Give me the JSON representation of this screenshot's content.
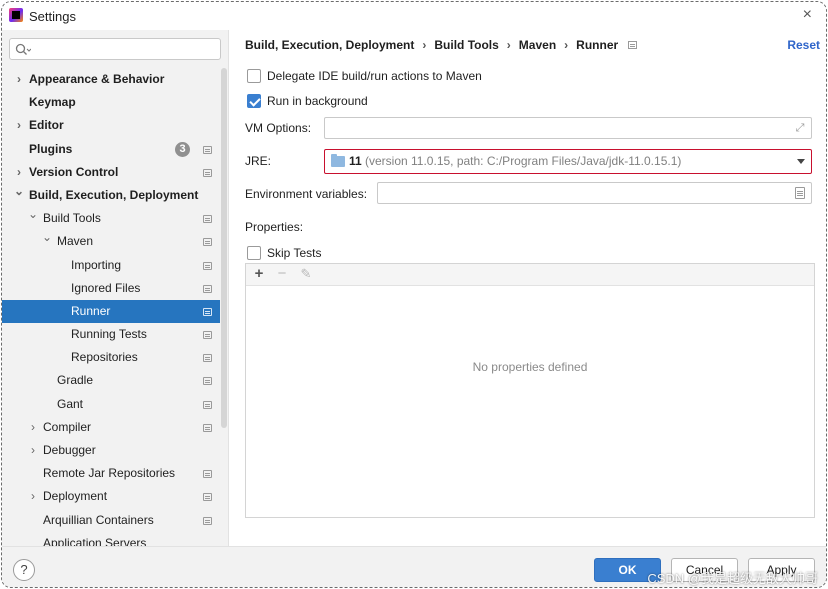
{
  "window": {
    "title": "Settings",
    "close_icon": "×"
  },
  "search": {
    "value": ""
  },
  "sidebar": {
    "items": [
      {
        "label": "Appearance & Behavior",
        "bold": true,
        "expandable": true,
        "expanded": false,
        "level": 0,
        "settings_icon": false
      },
      {
        "label": "Keymap",
        "bold": true,
        "expandable": false,
        "level": 0,
        "settings_icon": false
      },
      {
        "label": "Editor",
        "bold": true,
        "expandable": true,
        "expanded": false,
        "level": 0,
        "settings_icon": false
      },
      {
        "label": "Plugins",
        "bold": true,
        "expandable": false,
        "level": 0,
        "settings_icon": true,
        "badge": "3"
      },
      {
        "label": "Version Control",
        "bold": true,
        "expandable": true,
        "expanded": false,
        "level": 0,
        "settings_icon": true
      },
      {
        "label": "Build, Execution, Deployment",
        "bold": true,
        "expandable": true,
        "expanded": true,
        "level": 0,
        "settings_icon": false
      },
      {
        "label": "Build Tools",
        "bold": false,
        "expandable": true,
        "expanded": true,
        "level": 1,
        "settings_icon": true
      },
      {
        "label": "Maven",
        "bold": false,
        "expandable": true,
        "expanded": true,
        "level": 2,
        "settings_icon": true
      },
      {
        "label": "Importing",
        "bold": false,
        "expandable": false,
        "level": 3,
        "settings_icon": true
      },
      {
        "label": "Ignored Files",
        "bold": false,
        "expandable": false,
        "level": 3,
        "settings_icon": true
      },
      {
        "label": "Runner",
        "bold": false,
        "expandable": false,
        "level": 3,
        "settings_icon": true,
        "selected": true
      },
      {
        "label": "Running Tests",
        "bold": false,
        "expandable": false,
        "level": 3,
        "settings_icon": true
      },
      {
        "label": "Repositories",
        "bold": false,
        "expandable": false,
        "level": 3,
        "settings_icon": true
      },
      {
        "label": "Gradle",
        "bold": false,
        "expandable": false,
        "level": 2,
        "settings_icon": true
      },
      {
        "label": "Gant",
        "bold": false,
        "expandable": false,
        "level": 2,
        "settings_icon": true
      },
      {
        "label": "Compiler",
        "bold": false,
        "expandable": true,
        "expanded": false,
        "level": 1,
        "settings_icon": true
      },
      {
        "label": "Debugger",
        "bold": false,
        "expandable": true,
        "expanded": false,
        "level": 1,
        "settings_icon": false
      },
      {
        "label": "Remote Jar Repositories",
        "bold": false,
        "expandable": false,
        "level": 1,
        "settings_icon": true
      },
      {
        "label": "Deployment",
        "bold": false,
        "expandable": true,
        "expanded": false,
        "level": 1,
        "settings_icon": true
      },
      {
        "label": "Arquillian Containers",
        "bold": false,
        "expandable": false,
        "level": 1,
        "settings_icon": true
      },
      {
        "label": "Application Servers",
        "bold": false,
        "expandable": false,
        "level": 1,
        "settings_icon": false
      }
    ]
  },
  "breadcrumb": [
    "Build, Execution, Deployment",
    "Build Tools",
    "Maven",
    "Runner"
  ],
  "reset_label": "Reset",
  "runner": {
    "delegate_label": "Delegate IDE build/run actions to Maven",
    "delegate_checked": false,
    "background_label": "Run in background",
    "background_checked": true,
    "vm_options_label": "VM Options:",
    "vm_options_value": "",
    "jre_label": "JRE:",
    "jre_version": "11",
    "jre_detail": "(version 11.0.15, path: C:/Program Files/Java/jdk-11.0.15.1)",
    "env_label": "Environment variables:",
    "env_value": "",
    "properties_label": "Properties:",
    "skip_tests_label": "Skip Tests",
    "skip_tests_checked": false,
    "no_properties_text": "No properties defined",
    "toolbar": {
      "add": "+",
      "remove": "−",
      "edit": "✎"
    }
  },
  "footer": {
    "help": "?",
    "ok": "OK",
    "cancel": "Cancel",
    "apply": "Apply",
    "watermark": "CSDN @我是超级无敌大帅哥"
  },
  "colors": {
    "accent": "#2675bf",
    "link": "#2f65ca",
    "highlight_border": "#c8102e"
  }
}
